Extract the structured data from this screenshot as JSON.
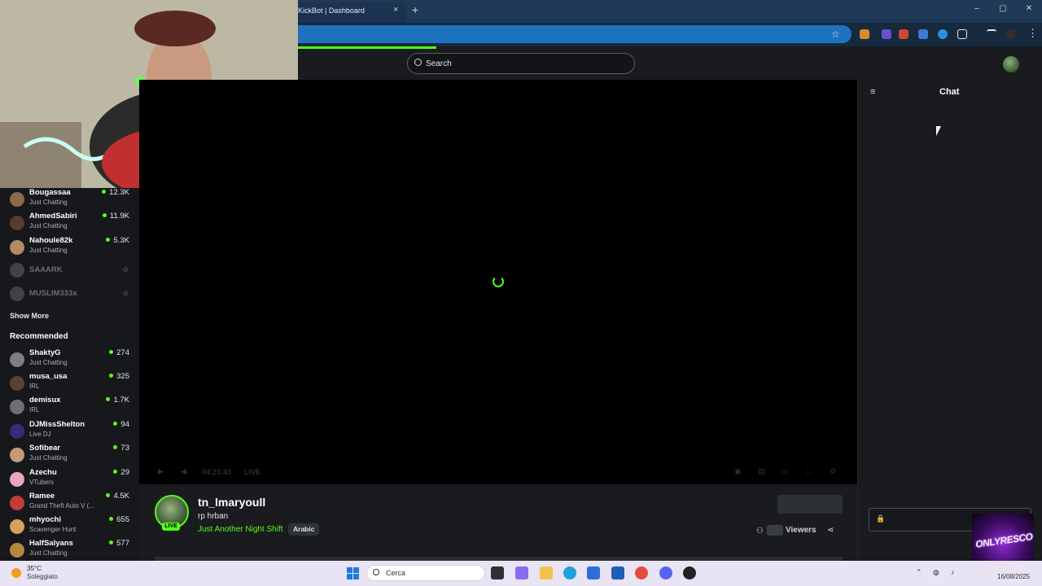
{
  "browser": {
    "tab_title": "KickBot | Dashboard",
    "tab_close": "×",
    "new_tab": "+",
    "window_controls": [
      "–",
      "▢",
      "✕"
    ]
  },
  "header": {
    "search_placeholder": "Search"
  },
  "sidebar": {
    "following": [
      {
        "name": "Bougassaa",
        "category": "Just Chatting",
        "viewers": "12.3K",
        "color": "#8a6a4a"
      },
      {
        "name": "AhmedSabiri",
        "category": "Just Chatting",
        "viewers": "11.9K",
        "color": "#5b3b2e"
      },
      {
        "name": "Nahoule82k",
        "category": "Just Chatting",
        "viewers": "5.3K",
        "color": "#b38a62"
      },
      {
        "name": "SAAARK",
        "offline": true,
        "color": "#6c6c6c"
      },
      {
        "name": "MUSLIM333x",
        "offline": true,
        "color": "#6c6c6c"
      }
    ],
    "show_more": "Show More",
    "recommended_title": "Recommended",
    "recommended": [
      {
        "name": "ShaktyG",
        "category": "Just Chatting",
        "viewers": "274",
        "color": "#7f7f7f"
      },
      {
        "name": "musa_usa",
        "category": "IRL",
        "viewers": "325",
        "color": "#5a4136"
      },
      {
        "name": "demisux",
        "category": "IRL",
        "viewers": "1.7K",
        "color": "#6f6f6f"
      },
      {
        "name": "DJMissShelton",
        "category": "Live DJ",
        "viewers": "94",
        "color": "#3b2a78"
      },
      {
        "name": "Sofibear",
        "category": "Just Chatting",
        "viewers": "73",
        "color": "#c49a7a"
      },
      {
        "name": "Azechu",
        "category": "VTubers",
        "viewers": "29",
        "color": "#e7a5b8"
      },
      {
        "name": "Ramee",
        "category": "Grand Theft Auto V (...",
        "viewers": "4.5K",
        "color": "#c23b3b"
      },
      {
        "name": "mhyochi",
        "category": "Scavenger Hunt",
        "viewers": "655",
        "color": "#d7a15a"
      },
      {
        "name": "HalfSalyans",
        "category": "Just Chatting",
        "viewers": "577",
        "color": "#b5873e"
      }
    ]
  },
  "player": {
    "elapsed": "04:23:43",
    "live_label": "LIVE"
  },
  "stream": {
    "streamer": "tn_lmaryoull",
    "live_badge": "LIVE",
    "title": "rp hrban",
    "category": "Just Another Night Shift",
    "tag": "Arabic",
    "viewers_label": "Viewers"
  },
  "chat": {
    "title": "Chat"
  },
  "overlay": {
    "logo_text": "ONLYRESCO"
  },
  "taskbar": {
    "temperature": "35°C",
    "weather": "Soleggiato",
    "search_label": "Cerca",
    "date": "16/08/2025"
  },
  "colors": {
    "accent": "#53fc18",
    "background": "#191b1f",
    "sidebar": "#16181c"
  }
}
